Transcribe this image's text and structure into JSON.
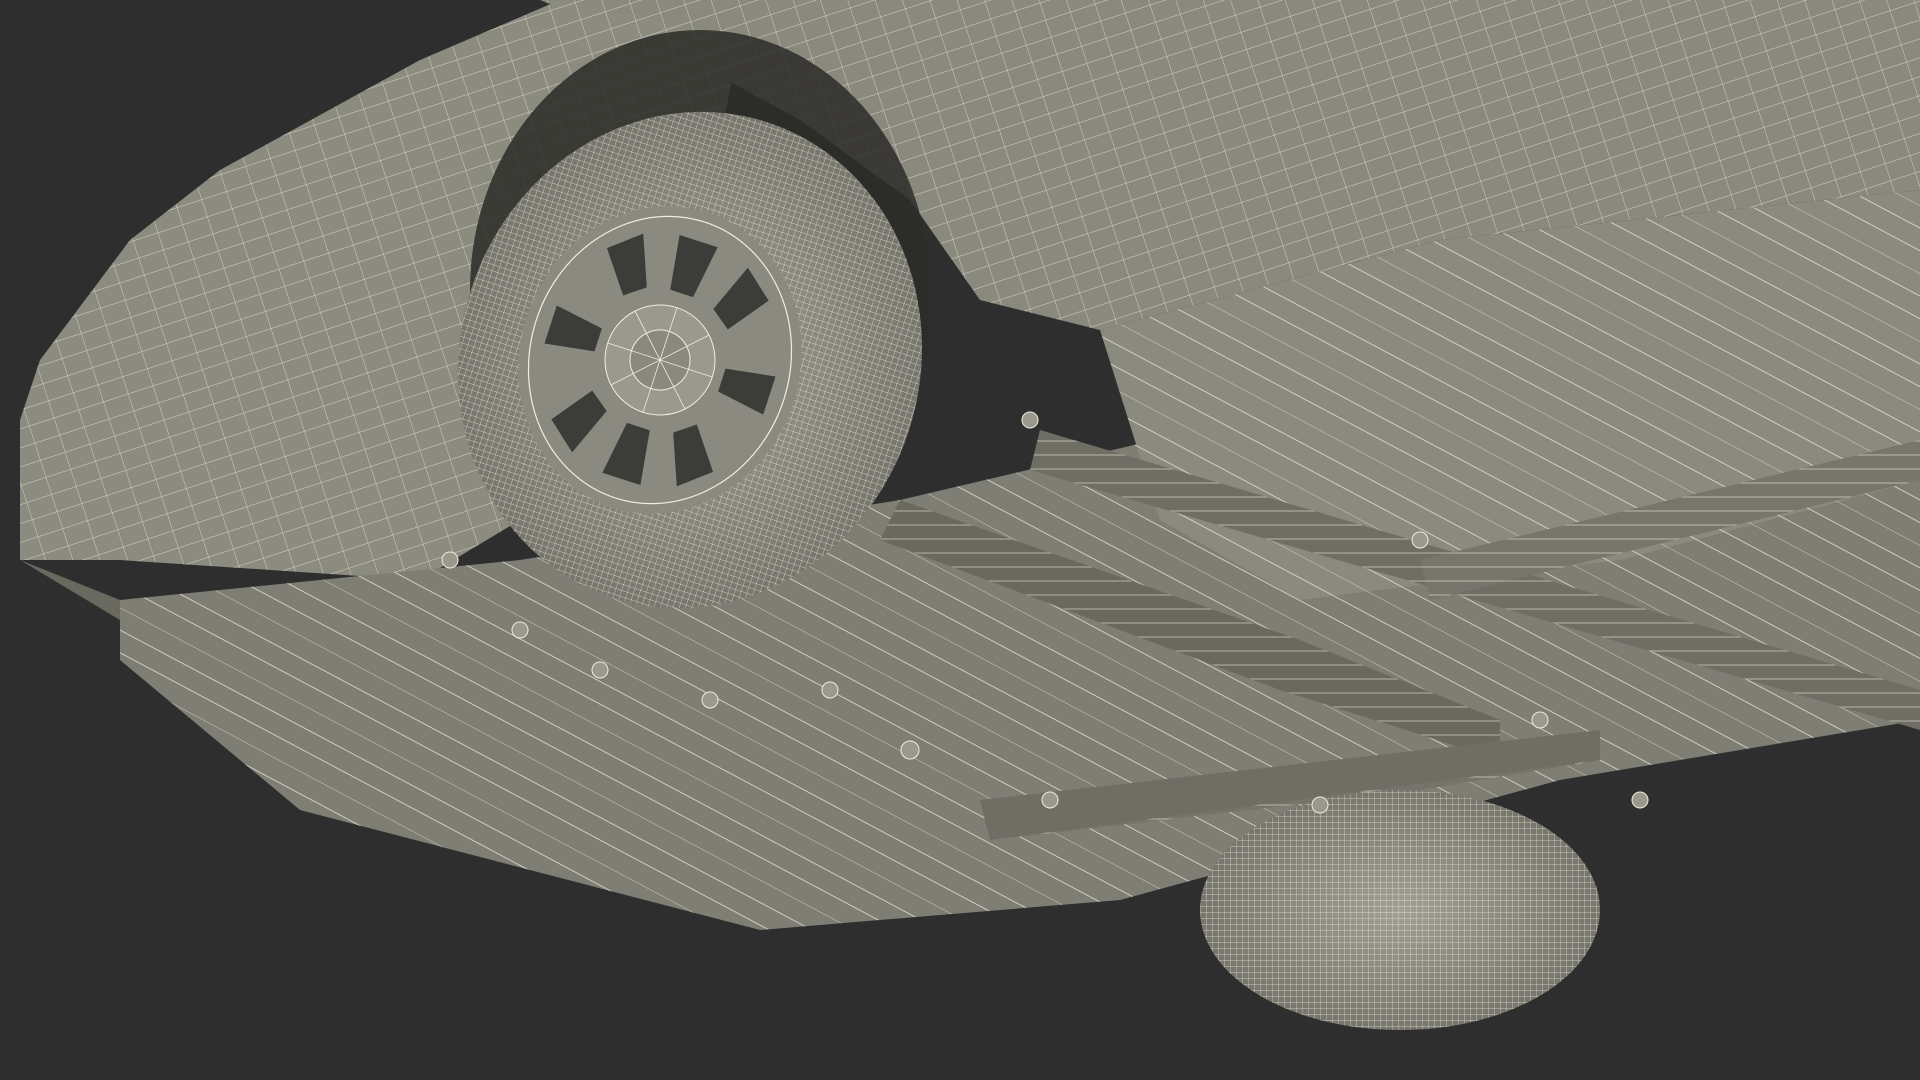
{
  "scene": {
    "subject": "car-underside-wireframe",
    "background_color": "#2e2e2e",
    "surface_color": "#86857a",
    "surface_shadow_color": "#5a5a52",
    "wire_color": "#f1eddc",
    "tire_color": "#8f8e84",
    "icons": [
      "wheel-icon",
      "rear-wheel-icon",
      "hubcap-icon",
      "bolt-icon"
    ]
  }
}
